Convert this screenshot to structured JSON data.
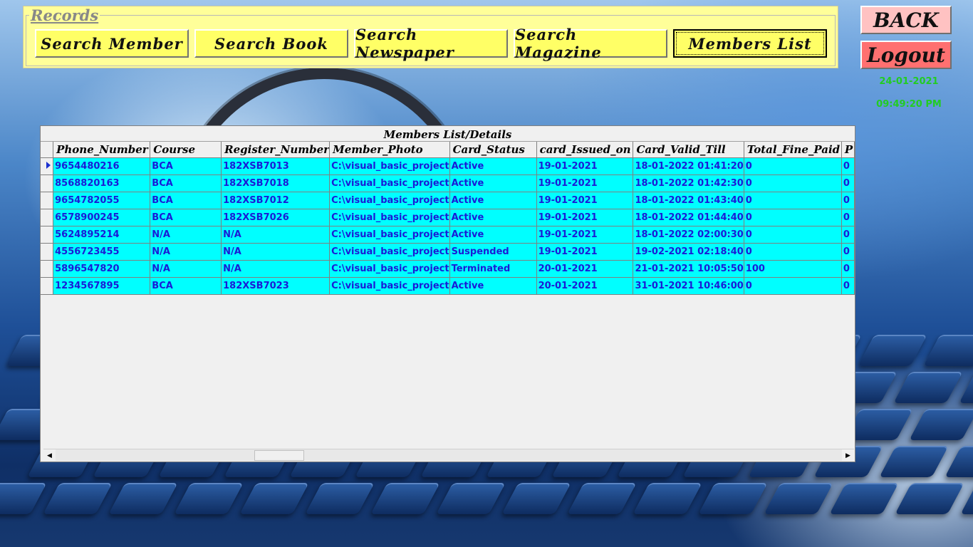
{
  "records": {
    "caption": "Records",
    "buttons": [
      {
        "label": "Search Member"
      },
      {
        "label": "Search Book"
      },
      {
        "label": "Search Newspaper"
      },
      {
        "label": "Search Magazine"
      },
      {
        "label": "Members List"
      }
    ]
  },
  "side": {
    "back_label": "BACK",
    "logout_label": "Logout",
    "date": "24-01-2021",
    "time": "09:49:20 PM"
  },
  "grid": {
    "caption": "Members List/Details",
    "columns": [
      "Phone_Number",
      "Course",
      "Register_Number",
      "Member_Photo",
      "Card_Status",
      "card_Issued_on",
      "Card_Valid_Till",
      "Total_Fine_Paid",
      "P"
    ],
    "rows": [
      [
        "9654480216",
        "BCA",
        "182XSB7013",
        "C:\\visual_basic_project",
        "Active",
        "19-01-2021",
        "18-01-2022 01:41:20",
        "0",
        "0"
      ],
      [
        "8568820163",
        "BCA",
        "182XSB7018",
        "C:\\visual_basic_project",
        "Active",
        "19-01-2021",
        "18-01-2022 01:42:30",
        "0",
        "0"
      ],
      [
        "9654782055",
        "BCA",
        "182XSB7012",
        "C:\\visual_basic_project",
        "Active",
        "19-01-2021",
        "18-01-2022 01:43:40",
        "0",
        "0"
      ],
      [
        "6578900245",
        "BCA",
        "182XSB7026",
        "C:\\visual_basic_project",
        "Active",
        "19-01-2021",
        "18-01-2022 01:44:40",
        "0",
        "0"
      ],
      [
        "5624895214",
        "N/A",
        "N/A",
        "C:\\visual_basic_project",
        "Active",
        "19-01-2021",
        "18-01-2022 02:00:30",
        "0",
        "0"
      ],
      [
        "4556723455",
        "N/A",
        "N/A",
        "C:\\visual_basic_project",
        "Suspended",
        "19-01-2021",
        "19-02-2021 02:18:40",
        "0",
        "0"
      ],
      [
        "5896547820",
        "N/A",
        "N/A",
        "C:\\visual_basic_project",
        "Terminated",
        "20-01-2021",
        "21-01-2021 10:05:50",
        "100",
        "0"
      ],
      [
        "1234567895",
        "BCA",
        "182XSB7023",
        "C:\\visual_basic_project",
        "Active",
        "20-01-2021",
        "31-01-2021 10:46:00",
        "0",
        "0"
      ]
    ]
  }
}
